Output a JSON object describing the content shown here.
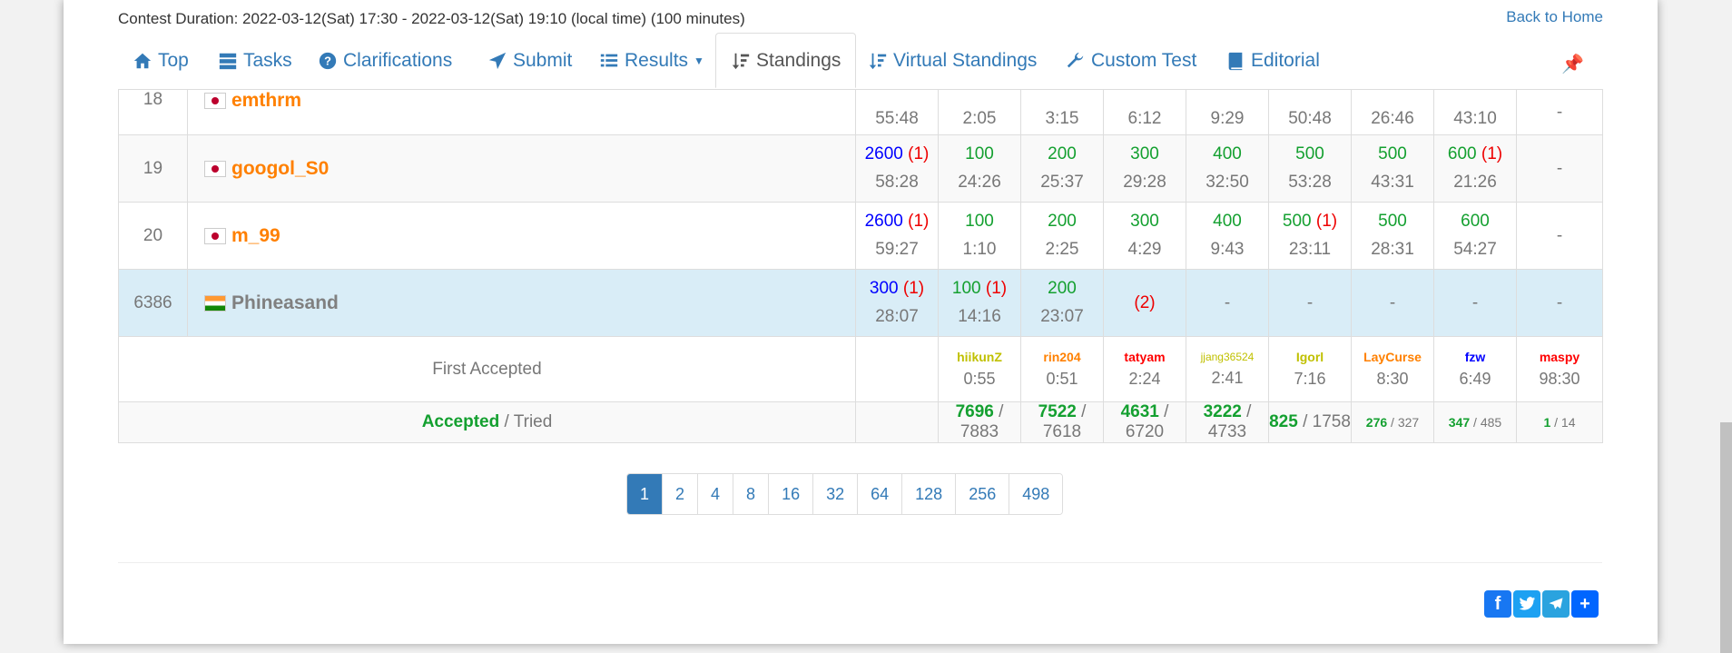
{
  "header": {
    "duration": "Contest Duration: 2022-03-12(Sat) 17:30 - 2022-03-12(Sat) 19:10 (local time) (100 minutes)",
    "back_home": "Back to Home"
  },
  "tabs": [
    {
      "label": "Top",
      "icon": "home-icon"
    },
    {
      "label": "Tasks",
      "icon": "tasks-icon"
    },
    {
      "label": "Clarifications",
      "icon": "question-circle-icon"
    },
    {
      "label": "Submit",
      "icon": "send-icon"
    },
    {
      "label": "Results",
      "icon": "list-icon"
    },
    {
      "label": "Standings",
      "icon": "sort-icon"
    },
    {
      "label": "Virtual Standings",
      "icon": "sort-icon"
    },
    {
      "label": "Custom Test",
      "icon": "wrench-icon"
    },
    {
      "label": "Editorial",
      "icon": "book-icon"
    }
  ],
  "rows": [
    {
      "rank": "18",
      "user": "emthrm",
      "flag": "jp",
      "total_time": "55:48",
      "cells": [
        {
          "score": "",
          "time": "2:05"
        },
        {
          "score": "",
          "time": "3:15"
        },
        {
          "score": "",
          "time": "6:12"
        },
        {
          "score": "",
          "time": "9:29"
        },
        {
          "score": "",
          "time": "50:48"
        },
        {
          "score": "",
          "time": "26:46"
        },
        {
          "score": "",
          "time": "43:10"
        },
        {
          "score": "-",
          "time": ""
        }
      ]
    },
    {
      "rank": "19",
      "user": "googol_S0",
      "flag": "jp",
      "total_score": "2600",
      "total_pen": "(1)",
      "total_time": "58:28",
      "cells": [
        {
          "score": "100",
          "time": "24:26"
        },
        {
          "score": "200",
          "time": "25:37"
        },
        {
          "score": "300",
          "time": "29:28"
        },
        {
          "score": "400",
          "time": "32:50"
        },
        {
          "score": "500",
          "time": "53:28"
        },
        {
          "score": "500",
          "time": "43:31"
        },
        {
          "score": "600",
          "pen": "(1)",
          "time": "21:26"
        },
        {
          "score": "-",
          "time": ""
        }
      ]
    },
    {
      "rank": "20",
      "user": "m_99",
      "flag": "jp",
      "total_score": "2600",
      "total_pen": "(1)",
      "total_time": "59:27",
      "cells": [
        {
          "score": "100",
          "time": "1:10"
        },
        {
          "score": "200",
          "time": "2:25"
        },
        {
          "score": "300",
          "time": "4:29"
        },
        {
          "score": "400",
          "time": "9:43"
        },
        {
          "score": "500",
          "pen": "(1)",
          "time": "23:11"
        },
        {
          "score": "500",
          "time": "28:31"
        },
        {
          "score": "600",
          "time": "54:27"
        },
        {
          "score": "-",
          "time": ""
        }
      ]
    },
    {
      "rank": "6386",
      "user": "Phineasand",
      "flag": "in",
      "total_score": "300",
      "total_pen": "(1)",
      "total_time": "28:07",
      "cells": [
        {
          "score": "100",
          "pen": "(1)",
          "time": "14:16"
        },
        {
          "score": "200",
          "time": "23:07"
        },
        {
          "score": "",
          "pen": "(2)",
          "time": ""
        },
        {
          "score": "-",
          "time": ""
        },
        {
          "score": "-",
          "time": ""
        },
        {
          "score": "-",
          "time": ""
        },
        {
          "score": "-",
          "time": ""
        },
        {
          "score": "-",
          "time": ""
        }
      ]
    }
  ],
  "first_accepted": {
    "label": "First Accepted",
    "entries": [
      {
        "user": "hiikunZ",
        "time": "0:55",
        "color": "#c0c000"
      },
      {
        "user": "rin204",
        "time": "0:51",
        "color": "#ff8000"
      },
      {
        "user": "tatyam",
        "time": "2:24",
        "color": "#ff0000"
      },
      {
        "user": "jjang36524",
        "time": "2:41",
        "color": "#c0c000"
      },
      {
        "user": "Igorl",
        "time": "7:16",
        "color": "#c0c000"
      },
      {
        "user": "LayCurse",
        "time": "8:30",
        "color": "#ff8000"
      },
      {
        "user": "fzw",
        "time": "6:49",
        "color": "#0000ff"
      },
      {
        "user": "maspy",
        "time": "98:30",
        "color": "#ff0000"
      }
    ]
  },
  "accepted_tried": {
    "label_accepted": "Accepted",
    "label_tried": " / Tried",
    "entries": [
      {
        "acc": "7696",
        "tried": " / 7883"
      },
      {
        "acc": "7522",
        "tried": " / 7618"
      },
      {
        "acc": "4631",
        "tried": " / 6720"
      },
      {
        "acc": "3222",
        "tried": " / 4733"
      },
      {
        "acc": "825",
        "tried": " / 1758"
      },
      {
        "acc": "276",
        "tried": " / 327"
      },
      {
        "acc": "347",
        "tried": " / 485"
      },
      {
        "acc": "1",
        "tried": " / 14"
      }
    ]
  },
  "pagination": [
    "1",
    "2",
    "4",
    "8",
    "16",
    "32",
    "64",
    "128",
    "256",
    "498"
  ],
  "pagination_active": "1",
  "share_buttons": [
    "facebook-icon",
    "twitter-icon",
    "telegram-icon",
    "share-plus-icon"
  ],
  "colors": {
    "accent": "#337ab7",
    "highlight_row": "#d9edf7",
    "accepted": "#14a030",
    "penalty": "#e00000",
    "total_score": "#0000ff"
  }
}
